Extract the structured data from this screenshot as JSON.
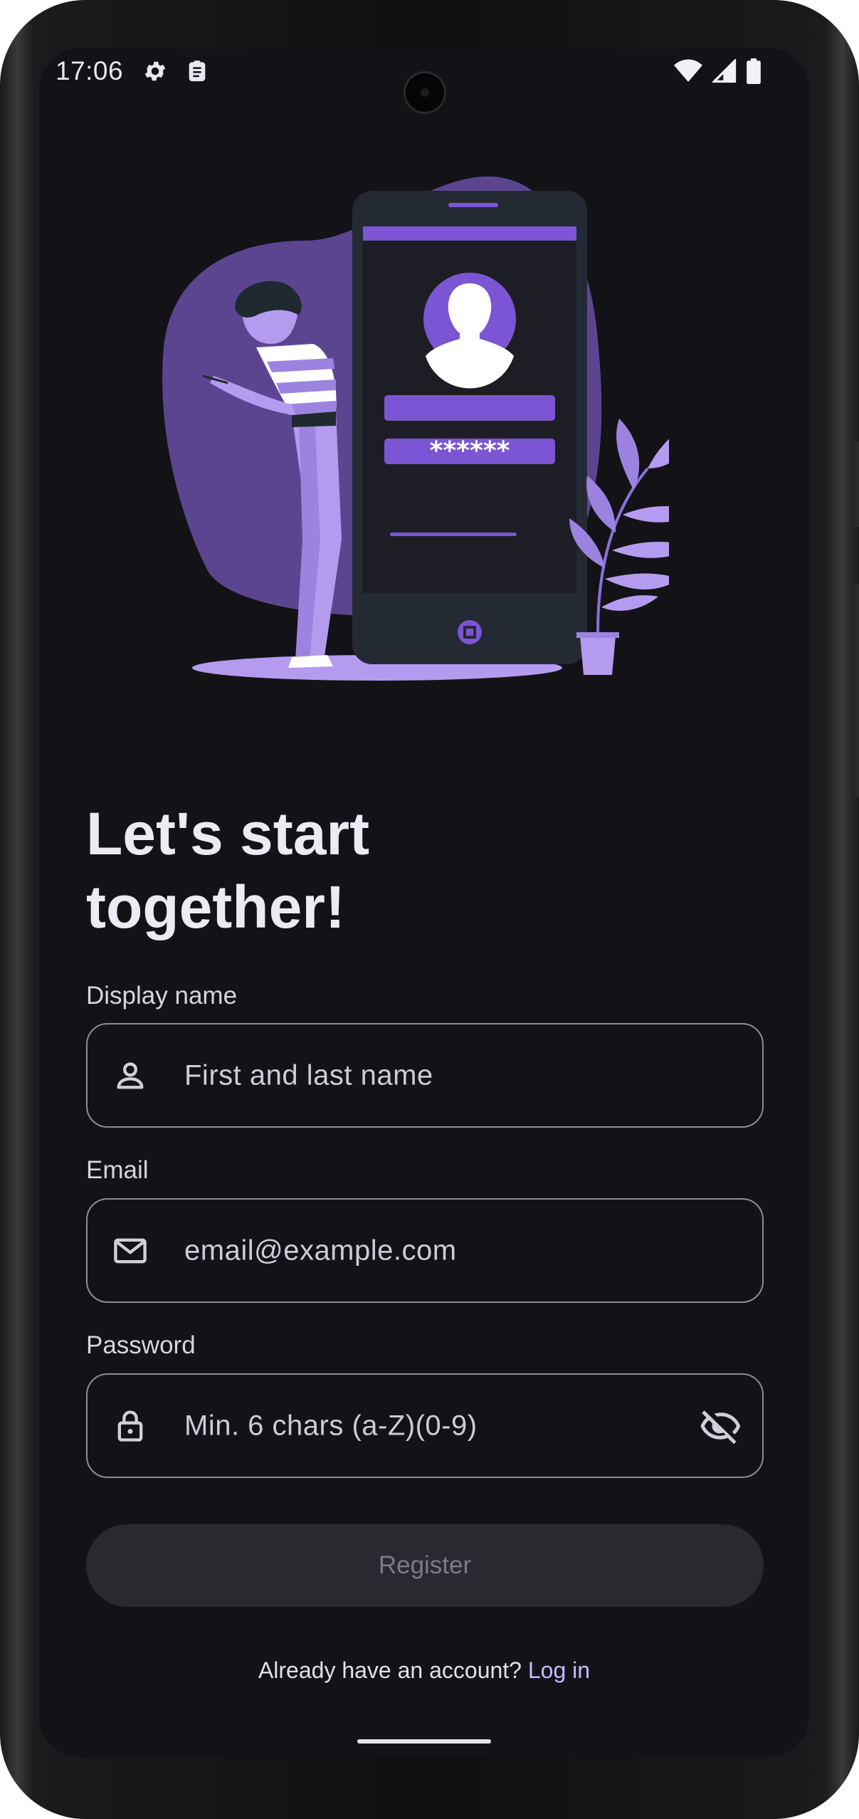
{
  "status_bar": {
    "time": "17:06",
    "left_icons": [
      "gear-icon",
      "clipboard-icon"
    ],
    "right_icons": [
      "wifi-icon",
      "signal-icon",
      "battery-icon"
    ]
  },
  "illustration": {
    "password_mask": "******"
  },
  "heading": {
    "line1": "Let's start",
    "line2": "together!"
  },
  "form": {
    "display_name": {
      "label": "Display name",
      "placeholder": "First and last name",
      "icon": "person-icon"
    },
    "email": {
      "label": "Email",
      "placeholder": "email@example.com",
      "icon": "mail-icon"
    },
    "password": {
      "label": "Password",
      "placeholder": "Min. 6 chars (a-Z)(0-9)",
      "icon": "lock-icon",
      "trailing_icon": "visibility-off-icon"
    }
  },
  "register_button": {
    "label": "Register",
    "enabled": false
  },
  "login_prompt": {
    "text": "Already have an account? ",
    "link": "Log in"
  },
  "colors": {
    "accent": "#7B55D3",
    "accent_light": "#B59BF0",
    "background": "#131317",
    "link": "#C9B8FF"
  }
}
